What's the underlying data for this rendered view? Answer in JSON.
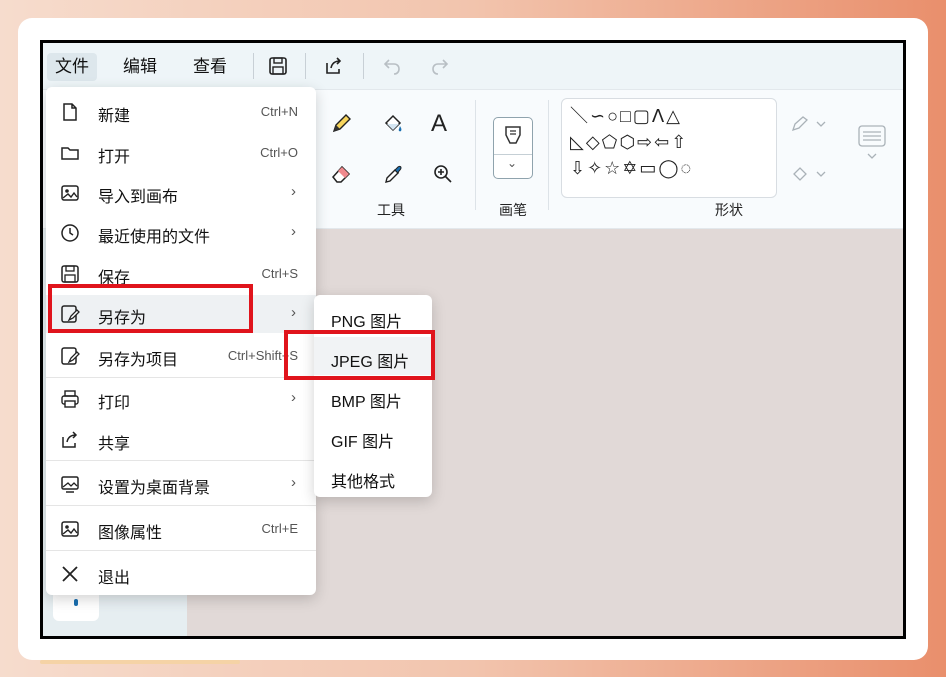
{
  "menubar": {
    "items": [
      "文件",
      "编辑",
      "查看"
    ]
  },
  "ribbon": {
    "tools_label": "工具",
    "brush_label": "画笔",
    "shapes_label": "形状",
    "text_tool_glyph": "A",
    "shapes_row1": "＼∽○□▢ᐱ△",
    "shapes_row2": "◺◇⬠⬡⇨⇦⇧",
    "shapes_row3": "⇩✧☆✡▭◯◌"
  },
  "file_menu": {
    "items": [
      {
        "label": "新建",
        "shortcut": "Ctrl+N",
        "icon": "new-file-icon"
      },
      {
        "label": "打开",
        "shortcut": "Ctrl+O",
        "icon": "folder-icon"
      },
      {
        "label": "导入到画布",
        "shortcut": "",
        "icon": "import-image-icon",
        "submenu": true
      },
      {
        "label": "最近使用的文件",
        "shortcut": "",
        "icon": "clock-icon",
        "submenu": true
      },
      {
        "label": "保存",
        "shortcut": "Ctrl+S",
        "icon": "save-icon"
      },
      {
        "label": "另存为",
        "shortcut": "",
        "icon": "save-as-icon",
        "submenu": true
      },
      {
        "label": "另存为项目",
        "shortcut": "Ctrl+Shift+S",
        "icon": "save-project-icon"
      },
      {
        "label": "打印",
        "shortcut": "",
        "icon": "printer-icon",
        "submenu": true
      },
      {
        "label": "共享",
        "shortcut": "",
        "icon": "share-icon"
      },
      {
        "label": "设置为桌面背景",
        "shortcut": "",
        "icon": "wallpaper-icon",
        "submenu": true
      },
      {
        "label": "图像属性",
        "shortcut": "Ctrl+E",
        "icon": "image-properties-icon"
      },
      {
        "label": "退出",
        "shortcut": "",
        "icon": "close-icon"
      }
    ],
    "submenu_arrow": "›"
  },
  "save_as_submenu": {
    "items": [
      "PNG 图片",
      "JPEG 图片",
      "BMP 图片",
      "GIF 图片",
      "其他格式"
    ]
  },
  "colors": {
    "highlight": "#e0141c",
    "canvas": "#e1d9d7",
    "accent_blue": "#1a6fb0"
  }
}
